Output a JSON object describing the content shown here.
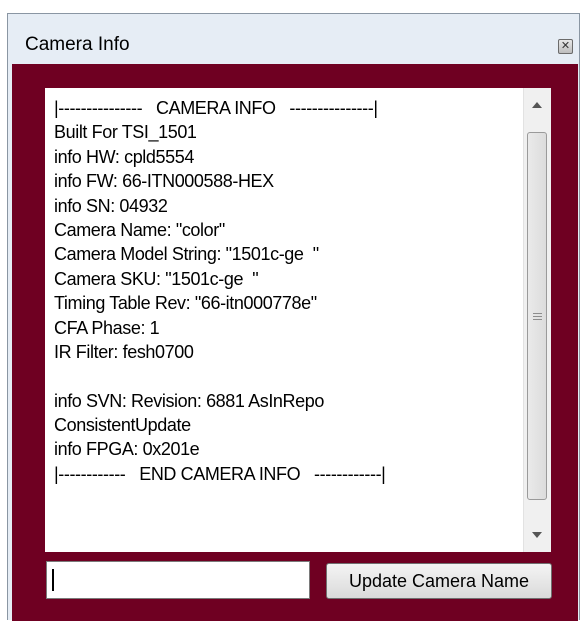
{
  "window": {
    "title": "Camera Info",
    "close_glyph": "✕"
  },
  "info_lines": [
    "|---------------   CAMERA INFO   ---------------|",
    "Built For TSI_1501",
    "info HW: cpld5554",
    "info FW: 66-ITN000588-HEX",
    "info SN: 04932",
    "Camera Name: \"color\"",
    "Camera Model String: \"1501c-ge  \"",
    "Camera SKU: \"1501c-ge  \"",
    "Timing Table Rev: \"66-itn000778e\"",
    "CFA Phase: 1",
    "IR Filter: fesh0700",
    "",
    "info SVN: Revision: 6881 AsInRepo",
    "ConsistentUpdate",
    "info FPGA: 0x201e",
    "|------------   END CAMERA INFO   ------------|"
  ],
  "name_input": {
    "value": "",
    "placeholder": ""
  },
  "update_button": {
    "label": "Update Camera Name"
  },
  "colors": {
    "client_background": "#6f0022",
    "window_frame": "#e6edf5"
  },
  "icons": {
    "close": "close-icon",
    "scroll_up": "scroll-up-arrow-icon",
    "scroll_down": "scroll-down-arrow-icon"
  }
}
